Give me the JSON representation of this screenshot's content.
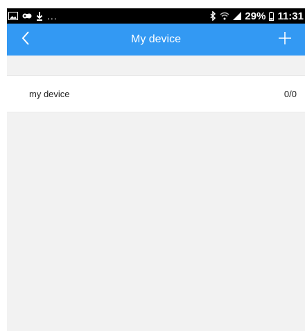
{
  "status_bar": {
    "notification_icons": [
      "image-icon",
      "controller-icon",
      "download-icon"
    ],
    "overflow": "...",
    "battery_percent": "29%",
    "time": "11:31"
  },
  "header": {
    "title": "My device",
    "back_icon": "chevron-left-icon",
    "add_icon": "plus-icon",
    "bg_color": "#3399f3"
  },
  "devices": [
    {
      "name": "my device",
      "count": "0/0"
    }
  ]
}
